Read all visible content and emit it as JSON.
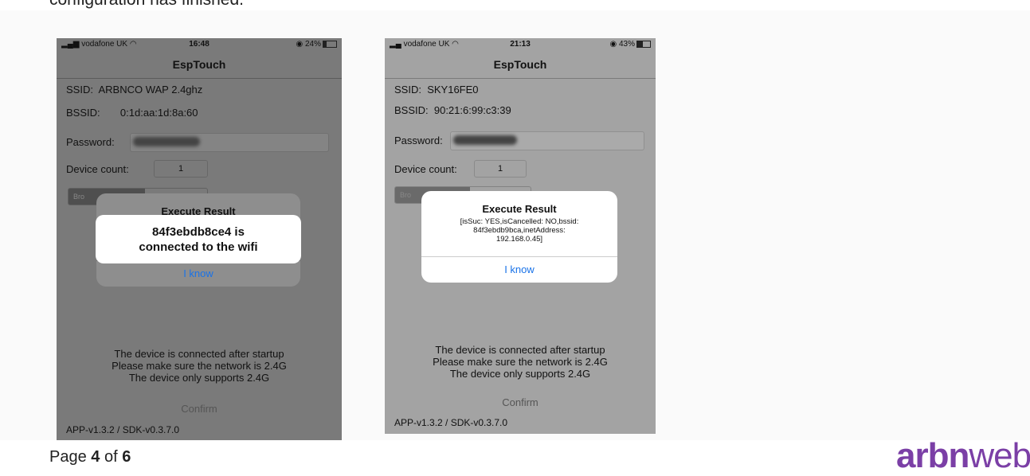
{
  "document": {
    "top_text": "configuration has finished.",
    "page_label_prefix": "Page ",
    "page_current": "4",
    "page_label_mid": " of ",
    "page_total": "6",
    "brand_bold": "arbn",
    "brand_light": "web"
  },
  "phones": [
    {
      "status": {
        "carrier": "vodafone UK",
        "time": "16:48",
        "battery": "24%",
        "battery_level": 0.24
      },
      "nav_title": "EspTouch",
      "ssid_label": "SSID:",
      "ssid_value": "ARBNCO WAP 2.4ghz",
      "bssid_label": "BSSID:",
      "bssid_value": "0:1d:aa:1d:8a:60",
      "password_label": "Password:",
      "device_count_label": "Device count:",
      "device_count_value": "1",
      "segment_label": "Bro",
      "alert": {
        "title": "Execute Result",
        "toast": "84f3ebdb8ce4 is connected to the wifi",
        "button": "I know"
      },
      "info_lines": [
        "The device is connected after startup",
        "Please make sure the network is 2.4G",
        "The device only supports 2.4G"
      ],
      "confirm_label": "Confirm",
      "version": "APP-v1.3.2 / SDK-v0.3.7.0"
    },
    {
      "status": {
        "carrier": "vodafone UK",
        "time": "21:13",
        "battery": "43%",
        "battery_level": 0.43
      },
      "nav_title": "EspTouch",
      "ssid_label": "SSID:",
      "ssid_value": "SKY16FE0",
      "bssid_label": "BSSID:",
      "bssid_value": "90:21:6:99:c3:39",
      "password_label": "Password:",
      "device_count_label": "Device count:",
      "device_count_value": "1",
      "segment_label": "Bro",
      "alert": {
        "title": "Execute Result",
        "message_lines": [
          "[isSuc: YES,isCancelled: NO,bssid:",
          "84f3ebdb9bca,inetAddress:",
          "192.168.0.45]"
        ],
        "button": "I know"
      },
      "info_lines": [
        "The device is connected after startup",
        "Please make sure the network is 2.4G",
        "The device only supports 2.4G"
      ],
      "confirm_label": "Confirm",
      "version": "APP-v1.3.2 / SDK-v0.3.7.0"
    }
  ],
  "colors": {
    "brand": "#7b3fa6",
    "alert_button": "#1a73e8"
  }
}
